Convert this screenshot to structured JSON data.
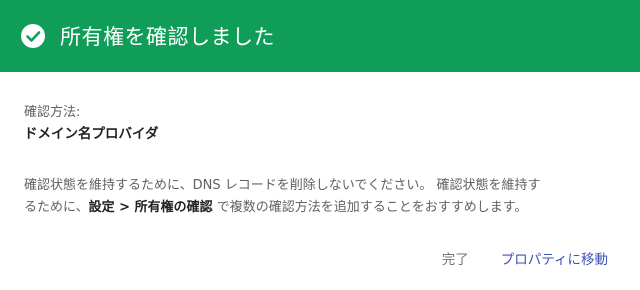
{
  "header": {
    "title": "所有権を確認しました",
    "icon": "check-circle-icon",
    "background_color": "#0f9d58"
  },
  "method": {
    "label": "確認方法:",
    "value": "ドメイン名プロバイダ"
  },
  "note": {
    "line1": "確認状態を維持するために、DNS レコードを削除しないでください。 確認状態を維持す",
    "line2_prefix": "るために、",
    "line2_bold": "設定 > 所有権の確認",
    "line2_suffix": " で複数の確認方法を追加することをおすすめします。"
  },
  "actions": {
    "done_label": "完了",
    "goto_label": "プロパティに移動",
    "accent_color": "#3f51b5"
  }
}
